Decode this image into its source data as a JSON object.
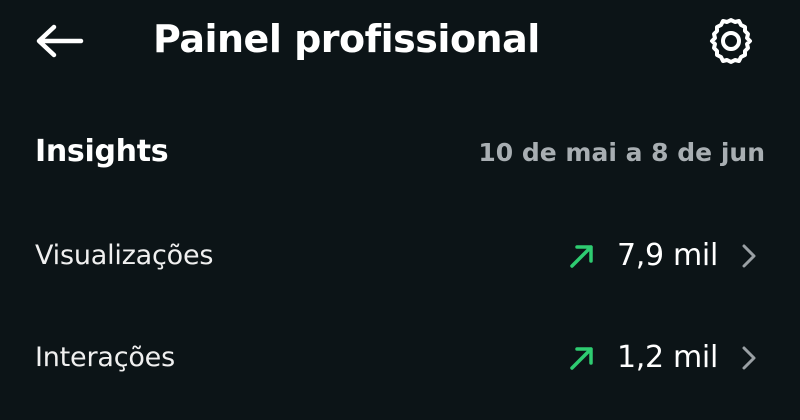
{
  "header": {
    "title": "Painel profissional",
    "back_icon": "arrow-left-icon",
    "settings_icon": "gear-icon"
  },
  "insights": {
    "title": "Insights",
    "date_range": "10 de mai a 8 de jun",
    "rows": [
      {
        "label": "Visualizações",
        "value": "7,9 mil",
        "trend": "up",
        "trend_icon": "trend-up-arrow-icon"
      },
      {
        "label": "Interações",
        "value": "1,2 mil",
        "trend": "up",
        "trend_icon": "trend-up-arrow-icon"
      }
    ]
  },
  "colors": {
    "background": "#0c1417",
    "trend_up": "#2ecc71",
    "muted_text": "#a8aeb2",
    "chevron": "#9aa0a4"
  }
}
